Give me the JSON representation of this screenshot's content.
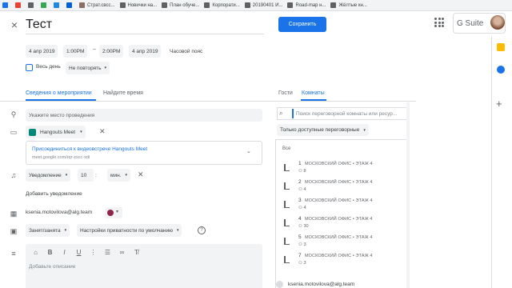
{
  "bookmarks": [
    {
      "label": "",
      "color": "#1a73e8"
    },
    {
      "label": "",
      "color": "#ea4335"
    },
    {
      "label": "",
      "color": "#5f6368"
    },
    {
      "label": "",
      "color": "#34a853"
    },
    {
      "label": "",
      "color": "#1e88e5"
    },
    {
      "label": "",
      "color": "#0061d5"
    },
    {
      "label": "Страт.свсс...",
      "color": "#8d6e63"
    },
    {
      "label": "Новички на...",
      "color": "#616161"
    },
    {
      "label": "План обуче...",
      "color": "#616161"
    },
    {
      "label": "Корпорати...",
      "color": "#616161"
    },
    {
      "label": "20190401 И...",
      "color": "#616161"
    },
    {
      "label": "Road-map н...",
      "color": "#616161"
    },
    {
      "label": "Жёлтые кн...",
      "color": "#616161"
    }
  ],
  "header": {
    "close_glyph": "×",
    "title": "Тест",
    "save_label": "Сохранить",
    "gsuite": "G Suite"
  },
  "dates": {
    "start_date": "4 апр 2019",
    "start_time": "1:00PM",
    "dash": "–",
    "end_time": "2:00PM",
    "end_date": "4 апр 2019",
    "timezone": "Часовой пояс"
  },
  "all_day_label": "Весь день",
  "repeat_label": "Не повторять",
  "tabs": {
    "details": "Сведения о мероприятии",
    "find_time": "Найдите время",
    "guests": "Гости",
    "rooms": "Комнаты"
  },
  "form": {
    "location_placeholder": "Укажите место проведения",
    "meet_label": "Hangouts Meet",
    "meet_join": "Присоединиться к видеовстрече Hangouts Meet",
    "meet_url": "meet.google.com/rqr-zscc-xdi",
    "notif_type": "Уведомление",
    "notif_value": "10",
    "notif_unit": "мин.",
    "add_notif": "Добавить уведомление",
    "owner": "ksenia.motovilova@alg.team",
    "status": "Занят/занята",
    "privacy": "Настройки приватности по умолчанию",
    "description_placeholder": "Добавьте описание"
  },
  "rooms_panel": {
    "search_placeholder": "Поиск переговорной комнаты или ресур...",
    "filter": "Только доступные переговорные",
    "all_label": "Все",
    "rooms": [
      {
        "num": "1",
        "name": "МОСКОВСКИЙ ОФИС • ЭТАЖ 4",
        "cap": "8"
      },
      {
        "num": "2",
        "name": "МОСКОВСКИЙ ОФИС • ЭТАЖ 4",
        "cap": "4"
      },
      {
        "num": "3",
        "name": "МОСКОВСКИЙ ОФИС • ЭТАЖ 4",
        "cap": "4"
      },
      {
        "num": "4",
        "name": "МОСКОВСКИЙ ОФИС • ЭТАЖ 4",
        "cap": "30"
      },
      {
        "num": "5",
        "name": "МОСКОВСКИЙ ОФИС • ЭТАЖ 4",
        "cap": "3"
      },
      {
        "num": "7",
        "name": "МОСКОВСКИЙ ОФИС • ЭТАЖ 4",
        "cap": "3"
      }
    ],
    "guest": "ksenia.motovilova@alg.team"
  },
  "colors": {
    "accent": "#1a73e8",
    "event_color": "#8e244c"
  }
}
